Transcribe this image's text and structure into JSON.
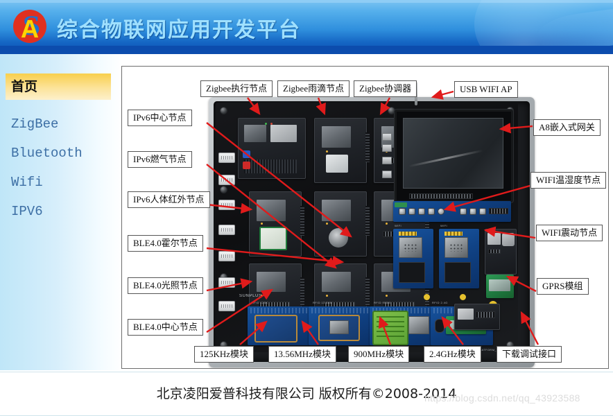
{
  "header": {
    "title": "综合物联网应用开发平台",
    "logo_letter": "A",
    "logo_swoosh": "S"
  },
  "sidebar": {
    "items": [
      {
        "label": "首页",
        "active": true
      },
      {
        "label": "ZigBee",
        "active": false
      },
      {
        "label": "Bluetooth",
        "active": false
      },
      {
        "label": "Wifi",
        "active": false
      },
      {
        "label": "IPV6",
        "active": false
      }
    ]
  },
  "footer": {
    "text": "北京凌阳爱普科技有限公司 版权所有©2008-2014",
    "watermark": "https://blog.csdn.net/qq_43923588"
  },
  "diagram": {
    "labels": {
      "zigbee_actuator": "Zigbee执行节点",
      "zigbee_raindrop": "Zigbee雨滴节点",
      "zigbee_coordinator": "Zigbee协调器",
      "usb_wifi_ap": "USB WIFI AP",
      "a8_gateway": "A8嵌入式网关",
      "ipv6_center": "IPv6中心节点",
      "ipv6_gas": "IPv6燃气节点",
      "ipv6_pir": "IPv6人体红外节点",
      "wifi_temp_humid": "WIFI温湿度节点",
      "ble_hall": "BLE4.0霍尔节点",
      "wifi_vibration": "WIFI震动节点",
      "ble_light": "BLE4.0光照节点",
      "gprs_module": "GPRS模组",
      "ble_center": "BLE4.0中心节点",
      "mod_125khz": "125KHz模块",
      "mod_1356mhz": "13.56MHz模块",
      "mod_900mhz": "900MHz模块",
      "mod_24ghz": "2.4GHz模块",
      "download_debug": "下载调试接口"
    },
    "board_silkscreen": {
      "brand": "SUNPLUS",
      "rfid_125k": "RFID 125K",
      "rfid_1356m": "RFID 13.56M",
      "rfid_900m": "RFID 900M",
      "rfid_24g": "RFID 2.4G",
      "platform": "ADVANCED_PLATFORM_V2.1",
      "wifi_1": "WIFI",
      "wifi_2": "WIFI"
    }
  },
  "colors": {
    "header_blue": "#1566c4",
    "title_blue": "#9fe0ff",
    "accent_yellow": "#f8cf4c",
    "arrow_red": "#e01b1b",
    "sidebar_blue": "#bfe6f8",
    "logo_red": "#e03020"
  }
}
